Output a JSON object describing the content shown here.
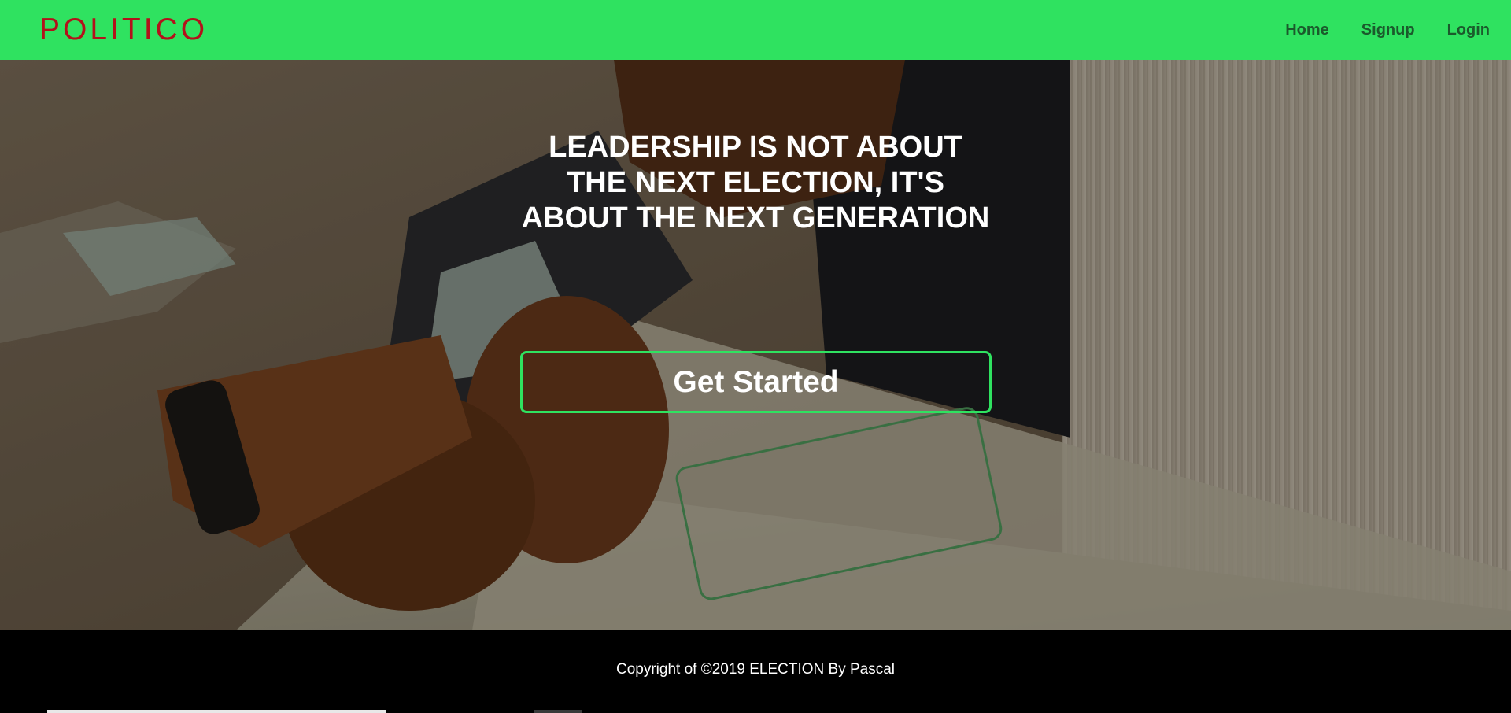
{
  "navbar": {
    "brand": "POLITICO",
    "links": [
      "Home",
      "Signup",
      "Login"
    ]
  },
  "hero": {
    "background_image": "photo of a hand holding a card reader over a voting ballot",
    "headline": "LEADERSHIP IS NOT ABOUT THE NEXT ELECTION, IT'S ABOUT THE NEXT GENERATION",
    "cta_label": "Get Started"
  },
  "footer": {
    "copyright": "Copyright of ©2019 ELECTION By Pascal"
  },
  "colors": {
    "navbar_bg": "#2fe260",
    "brand": "#b3121b",
    "nav_link": "#1b5a2c",
    "cta_border": "#2fe260",
    "footer_bg": "#000000"
  }
}
